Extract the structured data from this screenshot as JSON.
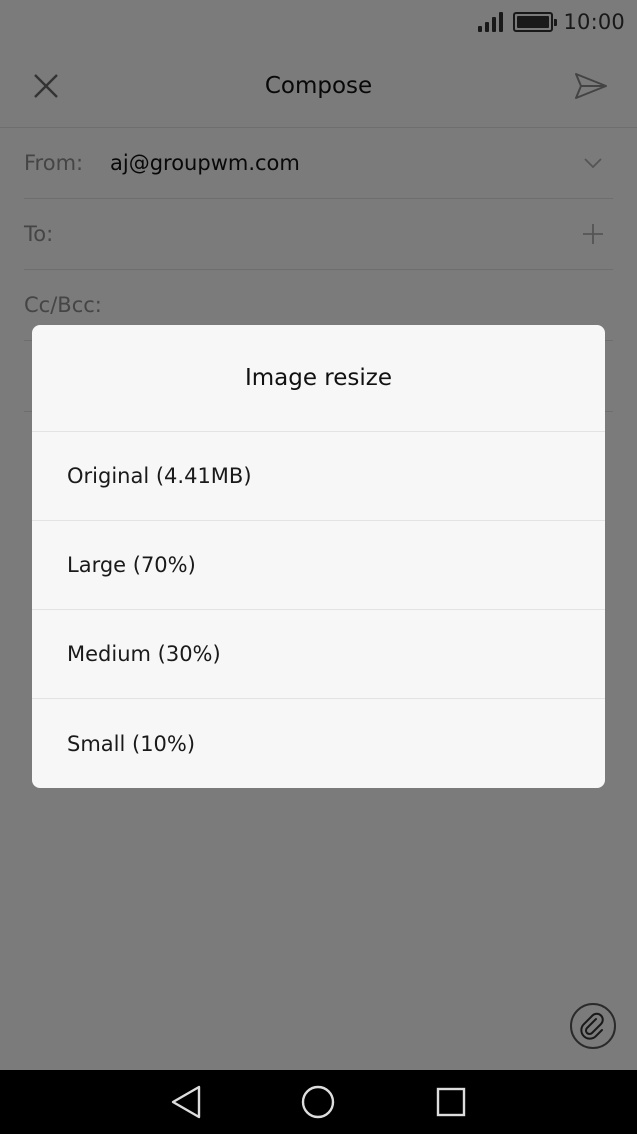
{
  "status_bar": {
    "time": "10:00",
    "signal_icon": "signal-icon",
    "battery_icon": "battery-icon"
  },
  "toolbar": {
    "title": "Compose",
    "close_icon": "close-icon",
    "send_icon": "send-icon"
  },
  "form": {
    "from_label": "From:",
    "from_value": "aj@groupwm.com",
    "to_label": "To:",
    "cc_label": "Cc/Bcc:"
  },
  "dialog": {
    "title": "Image resize",
    "options": [
      {
        "label": "Original (4.41MB)"
      },
      {
        "label": "Large (70%)"
      },
      {
        "label": "Medium (30%)"
      },
      {
        "label": "Small (10%)"
      }
    ]
  },
  "icons": {
    "attach": "paperclip-icon",
    "nav_back": "back-icon",
    "nav_home": "home-icon",
    "nav_recents": "recents-icon"
  },
  "colors": {
    "scrim": "#000000",
    "nav_bar": "#000000",
    "dialog_bg": "#f7f7f7"
  }
}
